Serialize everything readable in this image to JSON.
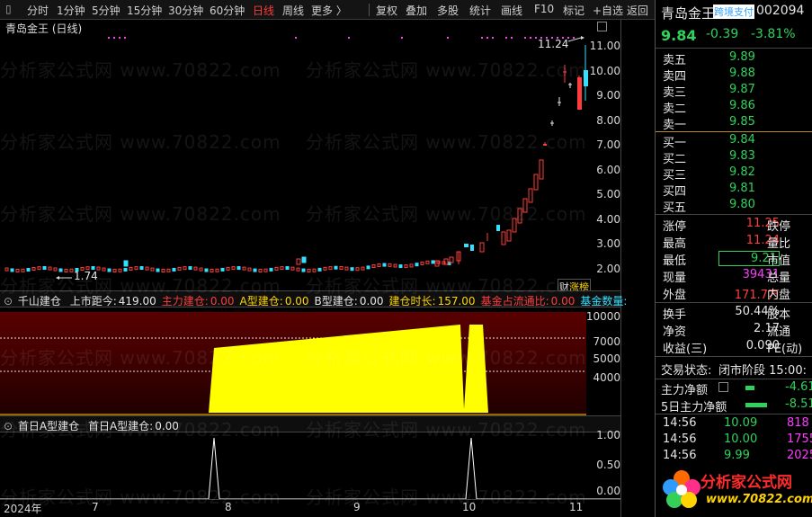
{
  "toolbar": {
    "left_items": [
      "分时",
      "1分钟",
      "5分钟",
      "15分钟",
      "30分钟",
      "60分钟",
      "日线",
      "周线",
      "更多 〉"
    ],
    "active_item": "日线",
    "right_items": [
      "复权",
      "叠加",
      "多股",
      "统计",
      "画线",
      "F10",
      "标记",
      "+自选",
      "返回"
    ]
  },
  "main_chart": {
    "title": "青岛金王 (日线)",
    "price_axis": [
      "11.00",
      "10.00",
      "9.00",
      "8.00",
      "7.00",
      "6.00",
      "5.00",
      "4.00",
      "3.00",
      "2.00"
    ],
    "high_label": "11.24",
    "low_label": "1.74",
    "badge_left": "财",
    "badge_right": "涨榜"
  },
  "indicator1": {
    "name": "千山建仓",
    "fields": [
      {
        "label": "上市距今:",
        "value": "419.00",
        "color": "white"
      },
      {
        "label": "主力建仓:",
        "value": "0.00",
        "color": "red"
      },
      {
        "label": "A型建仓:",
        "value": "0.00",
        "color": "yellow"
      },
      {
        "label": "B型建仓:",
        "value": "0.00",
        "color": "white"
      },
      {
        "label": "建仓时长:",
        "value": "157.00",
        "color": "yellow"
      },
      {
        "label": "基金占流通比:",
        "value": "0.00",
        "color": "red"
      },
      {
        "label": "基金数量:",
        "value": "",
        "color": "cyan"
      }
    ],
    "axis": [
      "10000",
      "7000",
      "5000",
      "4000"
    ]
  },
  "indicator2": {
    "name": "首日A型建仓",
    "field_label": "首日A型建仓:",
    "field_value": "0.00",
    "axis": [
      "1.00",
      "0.50",
      "0.00"
    ]
  },
  "date_axis": [
    "2024年",
    "7",
    "8",
    "9",
    "10",
    "11"
  ],
  "watermark": "分析家公式网 www.70822.com",
  "logo": {
    "name": "分析家公式网",
    "url": "www.70822.com"
  },
  "quote": {
    "stock_name": "青岛金王",
    "badge": "跨境支付",
    "code": "002094",
    "price": "9.84",
    "change": "-0.39",
    "change_pct": "-3.81%",
    "asks": [
      {
        "label": "卖五",
        "price": "9.89"
      },
      {
        "label": "卖四",
        "price": "9.88"
      },
      {
        "label": "卖三",
        "price": "9.87"
      },
      {
        "label": "卖二",
        "price": "9.86"
      },
      {
        "label": "卖一",
        "price": "9.85"
      }
    ],
    "bids": [
      {
        "label": "买一",
        "price": "9.84"
      },
      {
        "label": "买二",
        "price": "9.83"
      },
      {
        "label": "买三",
        "price": "9.82"
      },
      {
        "label": "买四",
        "price": "9.81"
      },
      {
        "label": "买五",
        "price": "9.80"
      }
    ],
    "stats": [
      {
        "label": "涨停",
        "value": "11.25",
        "color": "red",
        "right": "跌停"
      },
      {
        "label": "最高",
        "value": "11.24",
        "color": "red",
        "right": "量比"
      },
      {
        "label": "最低",
        "value": "9.21",
        "color": "green",
        "right": "市值"
      },
      {
        "label": "现量",
        "value": "39431",
        "color": "magenta",
        "right": "总量"
      },
      {
        "label": "外盘",
        "value": "171.7万",
        "color": "red",
        "right": "内盘"
      }
    ],
    "stats2": [
      {
        "label": "换手",
        "value": "50.44%",
        "right": "股本"
      },
      {
        "label": "净资",
        "value": "2.17",
        "right": "流通"
      },
      {
        "label": "收益(三)",
        "value": "0.090",
        "right": "PE(动)"
      }
    ],
    "trade_status_label": "交易状态:",
    "trade_status": "闭市阶段 15:00:",
    "main_net_label": "主力净额",
    "main_net": "-4.61",
    "main_net5_label": "5日主力净额",
    "main_net5": "-8.51",
    "ticks": [
      {
        "time": "14:56",
        "price": "10.09",
        "vol": "818"
      },
      {
        "time": "14:56",
        "price": "10.00",
        "vol": "1755"
      },
      {
        "time": "14:56",
        "price": "9.99",
        "vol": "2025"
      }
    ]
  },
  "colors": {
    "up": "#ff3d3d",
    "down": "#2fd35c",
    "fill": "#ffff00",
    "dark_red": "#3a0000"
  }
}
